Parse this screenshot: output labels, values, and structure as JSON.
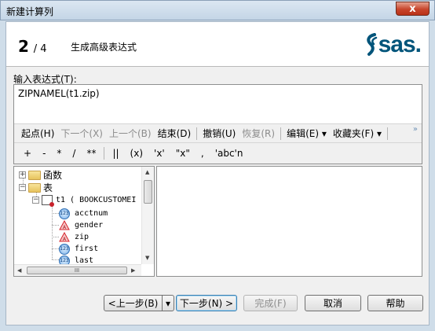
{
  "window": {
    "title": "新建计算列",
    "close_label": "x"
  },
  "header": {
    "current_step": "2",
    "total_steps": "/ 4",
    "step_title": "生成高级表达式",
    "logo_text": "sas."
  },
  "expression": {
    "label": "输入表达式(T):",
    "value": "ZIPNAMEL(t1.zip)"
  },
  "toolbar": {
    "start": "起点(H)",
    "next": "下一个(X)",
    "prev": "上一个(B)",
    "end": "结束(D)",
    "undo": "撤销(U)",
    "redo": "恢复(R)",
    "edit": "编辑(E) ▾",
    "favorites": "收藏夹(F) ▾",
    "more": "»"
  },
  "operators": [
    "+",
    "-",
    "*",
    "/",
    "**",
    "||",
    "(x)",
    "'x'",
    "\"x\"",
    ",",
    "'abc'n"
  ],
  "tree": {
    "functions": "函数",
    "tables": "表",
    "table_name": "t1 ( BOOKCUSTOMEI",
    "columns": [
      {
        "name": "acctnum",
        "type": "numeric",
        "icon": "123"
      },
      {
        "name": "gender",
        "type": "character",
        "icon": "A"
      },
      {
        "name": "zip",
        "type": "character",
        "icon": "A"
      },
      {
        "name": "first",
        "type": "numeric",
        "icon": "123"
      },
      {
        "name": "last",
        "type": "numeric",
        "icon": "123"
      }
    ],
    "hscroll_grip": "III"
  },
  "buttons": {
    "back": "<上一步(B)",
    "back_dropdown": "▾",
    "next": "下一步(N) >",
    "finish": "完成(F)",
    "cancel": "取消",
    "help": "帮助"
  },
  "colors": {
    "sas_blue": "#00547a",
    "close_red": "#c7452c"
  }
}
